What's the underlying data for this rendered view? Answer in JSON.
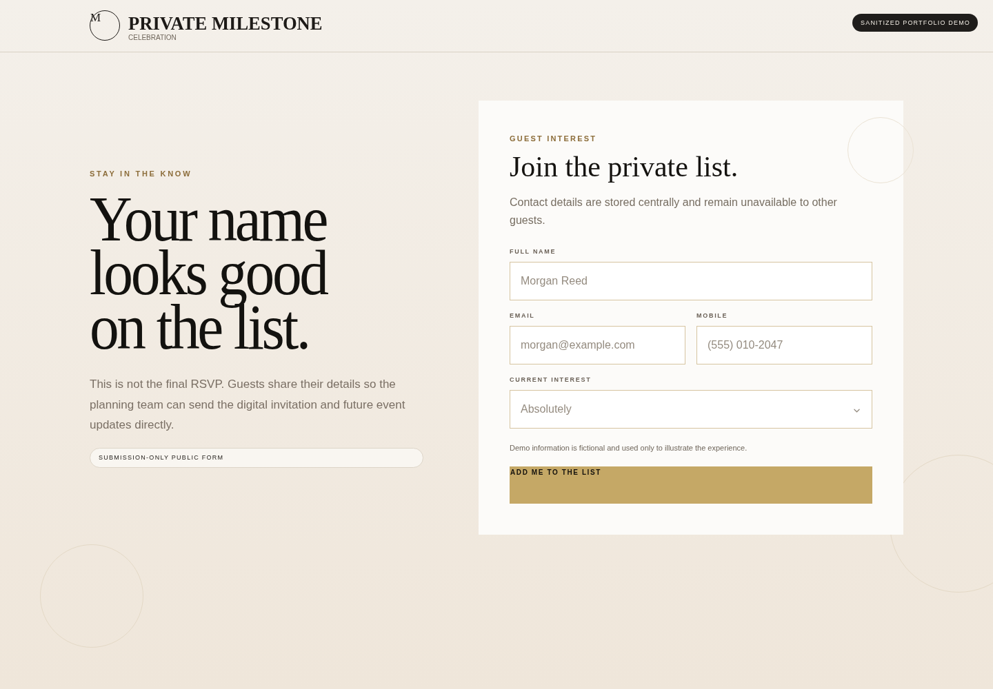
{
  "header": {
    "logo": {
      "monogram": "M",
      "title": "PRIVATE MILESTONE",
      "subtitle": "CELEBRATION"
    },
    "badge": "SANITIZED PORTFOLIO DEMO"
  },
  "intro": {
    "eyebrow": "STAY IN THE KNOW",
    "headline": [
      "Your name",
      "looks good",
      "on the list."
    ],
    "body": "This is not the final RSVP. Guests share their details so the planning team can send the digital invitation and future event updates directly.",
    "tag": "SUBMISSION-ONLY PUBLIC FORM"
  },
  "form": {
    "eyebrow": "GUEST INTEREST",
    "title": "Join the private list.",
    "description": "Contact details are stored centrally and remain unavailable to other guests.",
    "rows": [
      [
        {
          "kind": "text",
          "label": "FULL NAME",
          "placeholder": "Morgan Reed"
        }
      ],
      [
        {
          "kind": "text",
          "label": "EMAIL",
          "placeholder": "morgan@example.com"
        },
        {
          "kind": "text",
          "label": "MOBILE",
          "placeholder": "(555) 010-2047"
        }
      ],
      [
        {
          "kind": "select",
          "label": "CURRENT INTEREST",
          "value": "Absolutely"
        }
      ]
    ],
    "note": "Demo information is fictional and used only to illustrate the experience.",
    "submit": "ADD ME TO THE LIST"
  }
}
